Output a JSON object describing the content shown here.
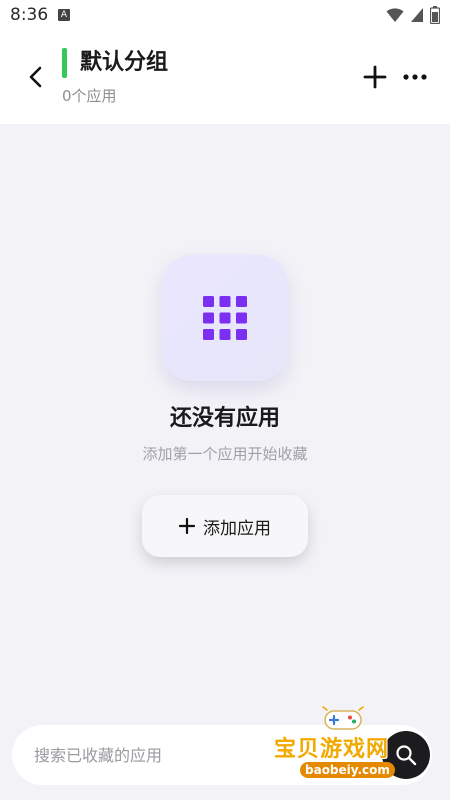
{
  "status_bar": {
    "time": "8:36",
    "app_badge": "A",
    "icons": [
      "wifi-icon",
      "signal-icon",
      "battery-icon"
    ]
  },
  "header": {
    "title": "默认分组",
    "subtitle": "0个应用",
    "accent_color": "#35c759",
    "icons": [
      "back-arrow-icon",
      "plus-icon",
      "more-icon"
    ]
  },
  "empty_state": {
    "title": "还没有应用",
    "subtitle": "添加第一个应用开始收藏",
    "icon": "app-grid-icon",
    "icon_color": "#7b2ff0",
    "add_button_label": "添加应用"
  },
  "search": {
    "placeholder": "搜索已收藏的应用",
    "icon": "search-icon"
  },
  "watermark": {
    "name": "宝贝游戏网",
    "url": "baobeiy.com"
  }
}
